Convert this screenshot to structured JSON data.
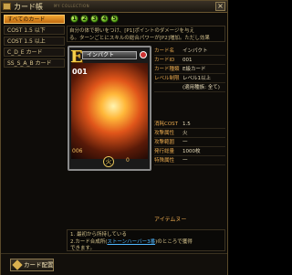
{
  "window": {
    "title": "カード帳",
    "subtitle": "MY COLLECTION",
    "close_label": "×"
  },
  "categories": [
    "すべてのカード",
    "COST 1.5 以下",
    "COST 1.5 以上",
    "C_D_E カード",
    "SS_S_A_B カード"
  ],
  "selected_category_index": 0,
  "number_tabs": [
    "1",
    "2",
    "3",
    "4",
    "5"
  ],
  "info_lines": [
    "自分の体で勢いをつけ、[P1]ポイントのダメージを与え",
    "る。ターンごとにスキルの総合パワーが[P2]増加。ただし効果"
  ],
  "card": {
    "rank": "E",
    "name": "インパクト",
    "number": "001",
    "cost_small": "006",
    "bottom_value": "0"
  },
  "details": [
    {
      "key": "カード名",
      "value": "インパクト"
    },
    {
      "key": "カードID",
      "value": "001"
    },
    {
      "key": "カード種類",
      "value": "E級カード"
    },
    {
      "key": "レベル制限",
      "value": "レベル1以上"
    },
    {
      "key": "",
      "value": "(適用種族: 全て)"
    },
    {
      "key": "消耗COST",
      "value": "1.5"
    },
    {
      "key": "攻撃属性",
      "value": "火"
    },
    {
      "key": "攻撃範囲",
      "value": "一"
    },
    {
      "key": "発行総量",
      "value": "1000枚"
    },
    {
      "key": "特殊属性",
      "value": "一"
    }
  ],
  "item_menu_label": "アイテムヌー",
  "notes": {
    "line1": "1. 最初から所持している",
    "line2_prefix": "2.カード合成所(",
    "line2_link": "ストーンハーバー3番",
    "line2_suffix": ")のところで獲得"
  },
  "line3": "できます。",
  "footer": {
    "deploy_label": "カード配置"
  }
}
